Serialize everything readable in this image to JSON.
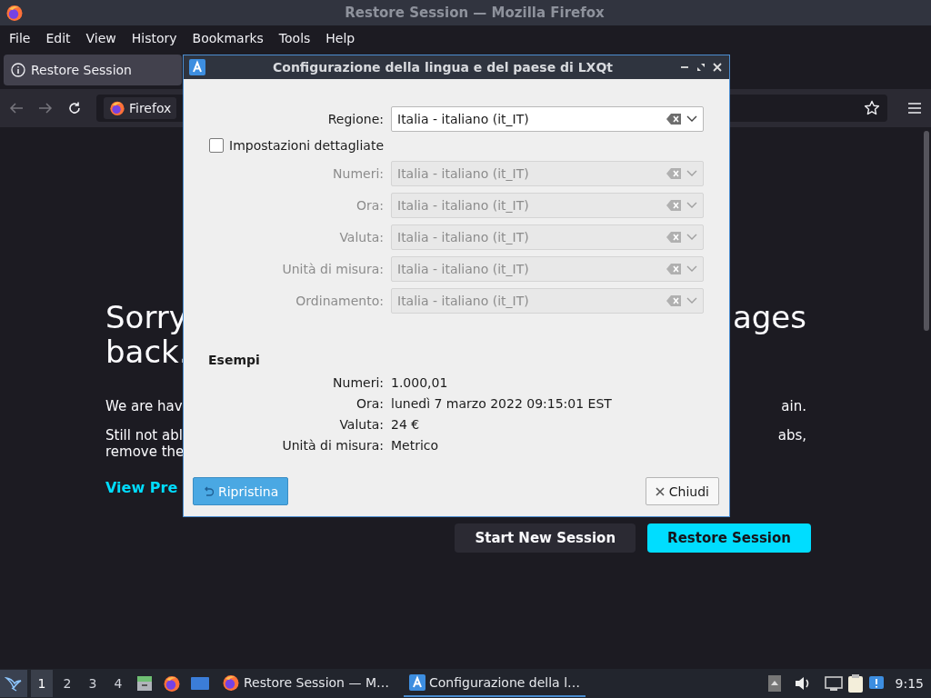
{
  "firefox": {
    "title": "Restore Session — Mozilla Firefox",
    "menu": [
      {
        "label": "File"
      },
      {
        "label": "Edit"
      },
      {
        "label": "View"
      },
      {
        "label": "History"
      },
      {
        "label": "Bookmarks"
      },
      {
        "label": "Tools"
      },
      {
        "label": "Help"
      }
    ],
    "tab": {
      "label": "Restore Session"
    },
    "url_bar": {
      "identity": "Firefox"
    },
    "page": {
      "heading_left": [
        "Sorry",
        "back."
      ],
      "heading_right": [
        "ages"
      ],
      "paragraphs": [
        {
          "left": [
            "We are hav"
          ],
          "right": [
            "ain."
          ]
        },
        {
          "left": [
            "Still not abl",
            "remove the"
          ],
          "right": [
            "abs,"
          ]
        }
      ],
      "link": "View Pre",
      "buttons": [
        {
          "label": "Start New Session",
          "kind": "secondary"
        },
        {
          "label": "Restore Session",
          "kind": "primary"
        }
      ]
    }
  },
  "dialog": {
    "title": "Configurazione della lingua e del paese di LXQt",
    "region": {
      "label": "Regione:",
      "value": "Italia - italiano (it_IT)",
      "disabled": false
    },
    "detailed": {
      "label": "Impostazioni dettagliate",
      "checked": false
    },
    "fields": [
      {
        "label": "Numeri:",
        "value": "Italia - italiano (it_IT)",
        "disabled": true
      },
      {
        "label": "Ora:",
        "value": "Italia - italiano (it_IT)",
        "disabled": true
      },
      {
        "label": "Valuta:",
        "value": "Italia - italiano (it_IT)",
        "disabled": true
      },
      {
        "label": "Unità di misura:",
        "value": "Italia - italiano (it_IT)",
        "disabled": true
      },
      {
        "label": "Ordinamento:",
        "value": "Italia - italiano (it_IT)",
        "disabled": true
      }
    ],
    "examples_title": "Esempi",
    "examples": [
      {
        "label": "Numeri:",
        "value": "1.000,01"
      },
      {
        "label": "Ora:",
        "value": "lunedì 7 marzo 2022 09:15:01 EST"
      },
      {
        "label": "Valuta:",
        "value": "24 €"
      },
      {
        "label": "Unità di misura:",
        "value": "Metrico"
      }
    ],
    "buttons": [
      {
        "label": "Ripristina",
        "kind": "reset"
      },
      {
        "label": "Chiudi",
        "kind": "close"
      }
    ]
  },
  "taskbar": {
    "desktops": [
      {
        "label": "1",
        "selected": true
      },
      {
        "label": "2",
        "selected": false
      },
      {
        "label": "3",
        "selected": false
      },
      {
        "label": "4",
        "selected": false
      }
    ],
    "tasks": [
      {
        "label": "Restore Session — M…",
        "kind": "firefox",
        "selected": false
      },
      {
        "label": "Configurazione della l…",
        "kind": "settings",
        "selected": true
      }
    ],
    "clock": "9:15"
  }
}
